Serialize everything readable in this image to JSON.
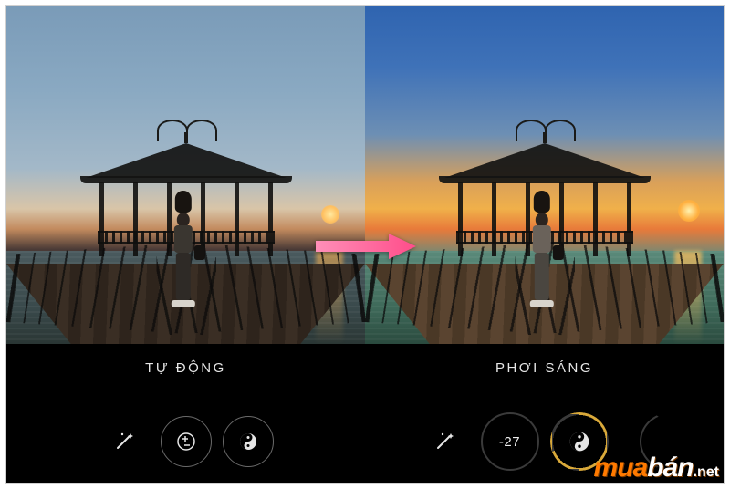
{
  "left": {
    "label": "TỰ ĐỘNG",
    "controls": {
      "wand": "auto-enhance",
      "exposure": "exposure",
      "contrast": "contrast"
    }
  },
  "right": {
    "label": "PHƠI SÁNG",
    "controls": {
      "wand": "auto-enhance",
      "value": "-27",
      "active_tool": "contrast"
    }
  },
  "watermark": {
    "part1": "mua",
    "part2": "bán",
    "suffix": ".net"
  }
}
